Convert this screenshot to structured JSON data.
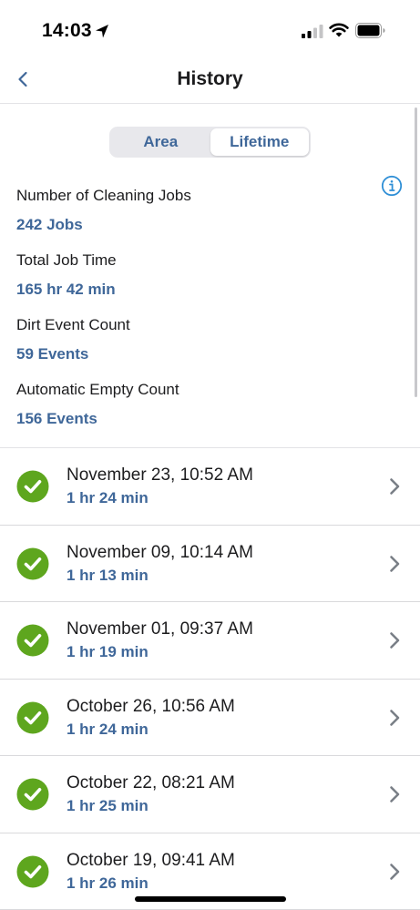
{
  "status_bar": {
    "time": "14:03"
  },
  "nav": {
    "title": "History"
  },
  "segments": [
    {
      "label": "Area",
      "active": false
    },
    {
      "label": "Lifetime",
      "active": true
    }
  ],
  "stats": [
    {
      "label": "Number of Cleaning Jobs",
      "value": "242 Jobs"
    },
    {
      "label": "Total Job Time",
      "value": "165 hr 42 min"
    },
    {
      "label": "Dirt Event Count",
      "value": "59 Events"
    },
    {
      "label": "Automatic Empty Count",
      "value": "156 Events"
    }
  ],
  "jobs": [
    {
      "date": "November 23, 10:52 AM",
      "duration": "1 hr 24 min"
    },
    {
      "date": "November 09, 10:14 AM",
      "duration": "1 hr 13 min"
    },
    {
      "date": "November 01, 09:37 AM",
      "duration": "1 hr 19 min"
    },
    {
      "date": "October 26, 10:56 AM",
      "duration": "1 hr 24 min"
    },
    {
      "date": "October 22, 08:21 AM",
      "duration": "1 hr 25 min"
    },
    {
      "date": "October 19, 09:41 AM",
      "duration": "1 hr 26 min"
    }
  ],
  "colors": {
    "accent": "#3f6799",
    "success": "#5ea61e",
    "chevron": "#7a7f87"
  },
  "icons": {
    "back": "chevron-left-icon",
    "info": "info-icon",
    "status": "checkmark-circle-icon",
    "row": "chevron-right-icon"
  }
}
